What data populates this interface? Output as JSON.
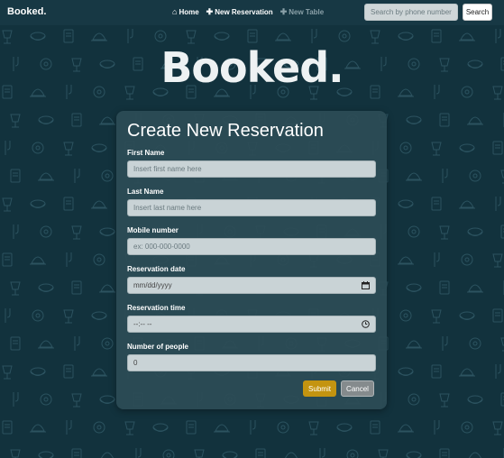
{
  "navbar": {
    "brand": "Booked.",
    "links": [
      {
        "label": "Home",
        "icon": "home-icon",
        "active": true
      },
      {
        "label": "New Reservation",
        "icon": "plus-icon",
        "active": true
      },
      {
        "label": "New Table",
        "icon": "plus-icon",
        "active": false
      }
    ],
    "search_placeholder": "Search by phone number",
    "search_label": "Search"
  },
  "hero": {
    "title": "Booked."
  },
  "form": {
    "title": "Create New Reservation",
    "fields": [
      {
        "label": "First Name",
        "placeholder": "Insert first name here",
        "value": ""
      },
      {
        "label": "Last Name",
        "placeholder": "Insert last name here",
        "value": ""
      },
      {
        "label": "Mobile number",
        "placeholder": "ex: 000-000-0000",
        "value": ""
      },
      {
        "label": "Reservation date",
        "placeholder": "mm/dd/yyyy",
        "value": "",
        "icon": "calendar-icon"
      },
      {
        "label": "Reservation time",
        "placeholder": "--:-- --",
        "value": "",
        "icon": "clock-icon"
      },
      {
        "label": "Number of people",
        "placeholder": "",
        "value": "0"
      }
    ],
    "submit_label": "Submit",
    "cancel_label": "Cancel"
  },
  "colors": {
    "background": "#12323d",
    "navbar": "#173844",
    "card": "#2c4c56",
    "submit": "#c49410",
    "cancel": "#858b8d"
  }
}
